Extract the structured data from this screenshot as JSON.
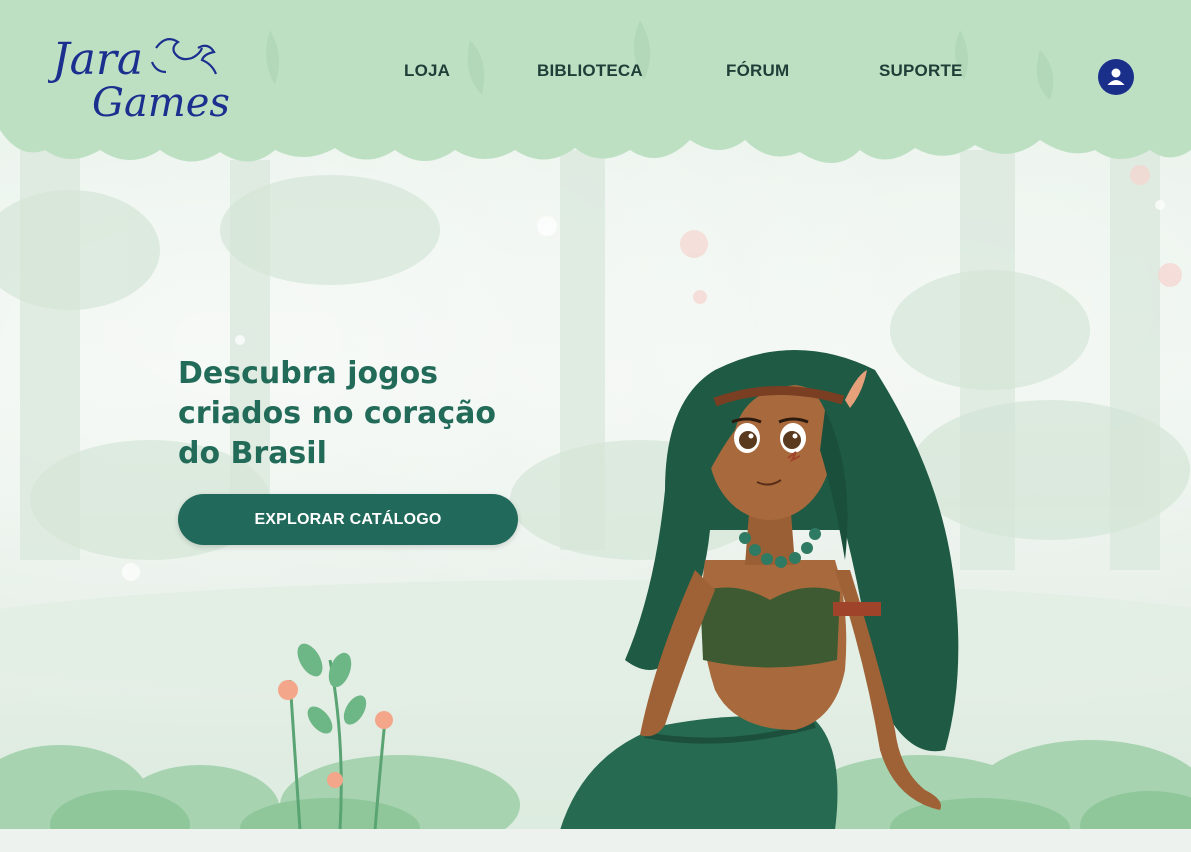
{
  "brand": {
    "logo_line1": "Jara",
    "logo_line2": "Games",
    "logo_color": "#1b2f8f"
  },
  "nav": {
    "items": [
      {
        "label": "LOJA"
      },
      {
        "label": "BIBLIOTECA"
      },
      {
        "label": "FÓRUM"
      },
      {
        "label": "SUPORTE"
      }
    ],
    "user_icon": "user-account-icon"
  },
  "hero": {
    "headline": "Descubra jogos criados no coração do Brasil",
    "cta_label": "EXPLORAR CATÁLOGO"
  },
  "colors": {
    "accent": "#21695a",
    "headline": "#236b59",
    "header_green": "#bde0c3",
    "nav_text": "#1f3e38",
    "user_icon_bg": "#1a2f8a"
  }
}
